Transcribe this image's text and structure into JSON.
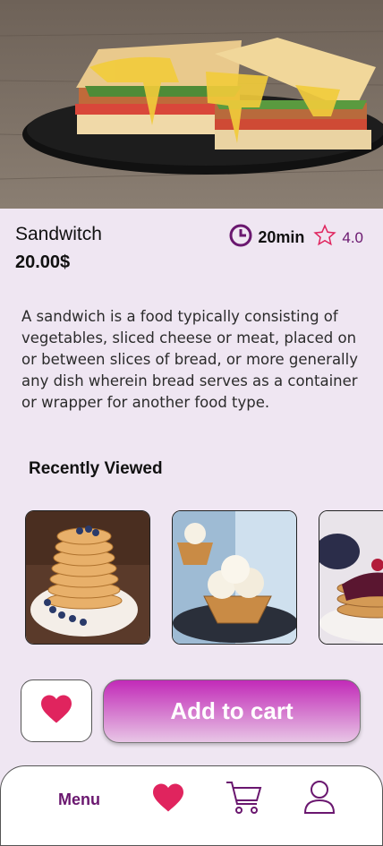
{
  "product": {
    "name": "Sandwitch",
    "price": "20.00$",
    "time": "20min",
    "rating": "4.0",
    "description": "A sandwich is a food typically consisting of vegetables, sliced cheese or meat, placed on or between slices of bread, or more generally any dish wherein bread serves as a container or wrapper for another food type."
  },
  "recently_viewed": {
    "title": "Recently Viewed",
    "items": [
      {
        "icon": "pancake-stack-image"
      },
      {
        "icon": "ice-cream-cone-image"
      },
      {
        "icon": "pancakes-berries-image"
      }
    ]
  },
  "actions": {
    "add_to_cart_label": "Add to cart"
  },
  "nav": {
    "menu_label": "Menu",
    "items": [
      "menu",
      "favorites-icon",
      "cart-icon",
      "profile-icon"
    ]
  },
  "colors": {
    "accent": "#6a176f",
    "heart": "#e0245e",
    "cart_gradient_top": "#c22ab8"
  }
}
